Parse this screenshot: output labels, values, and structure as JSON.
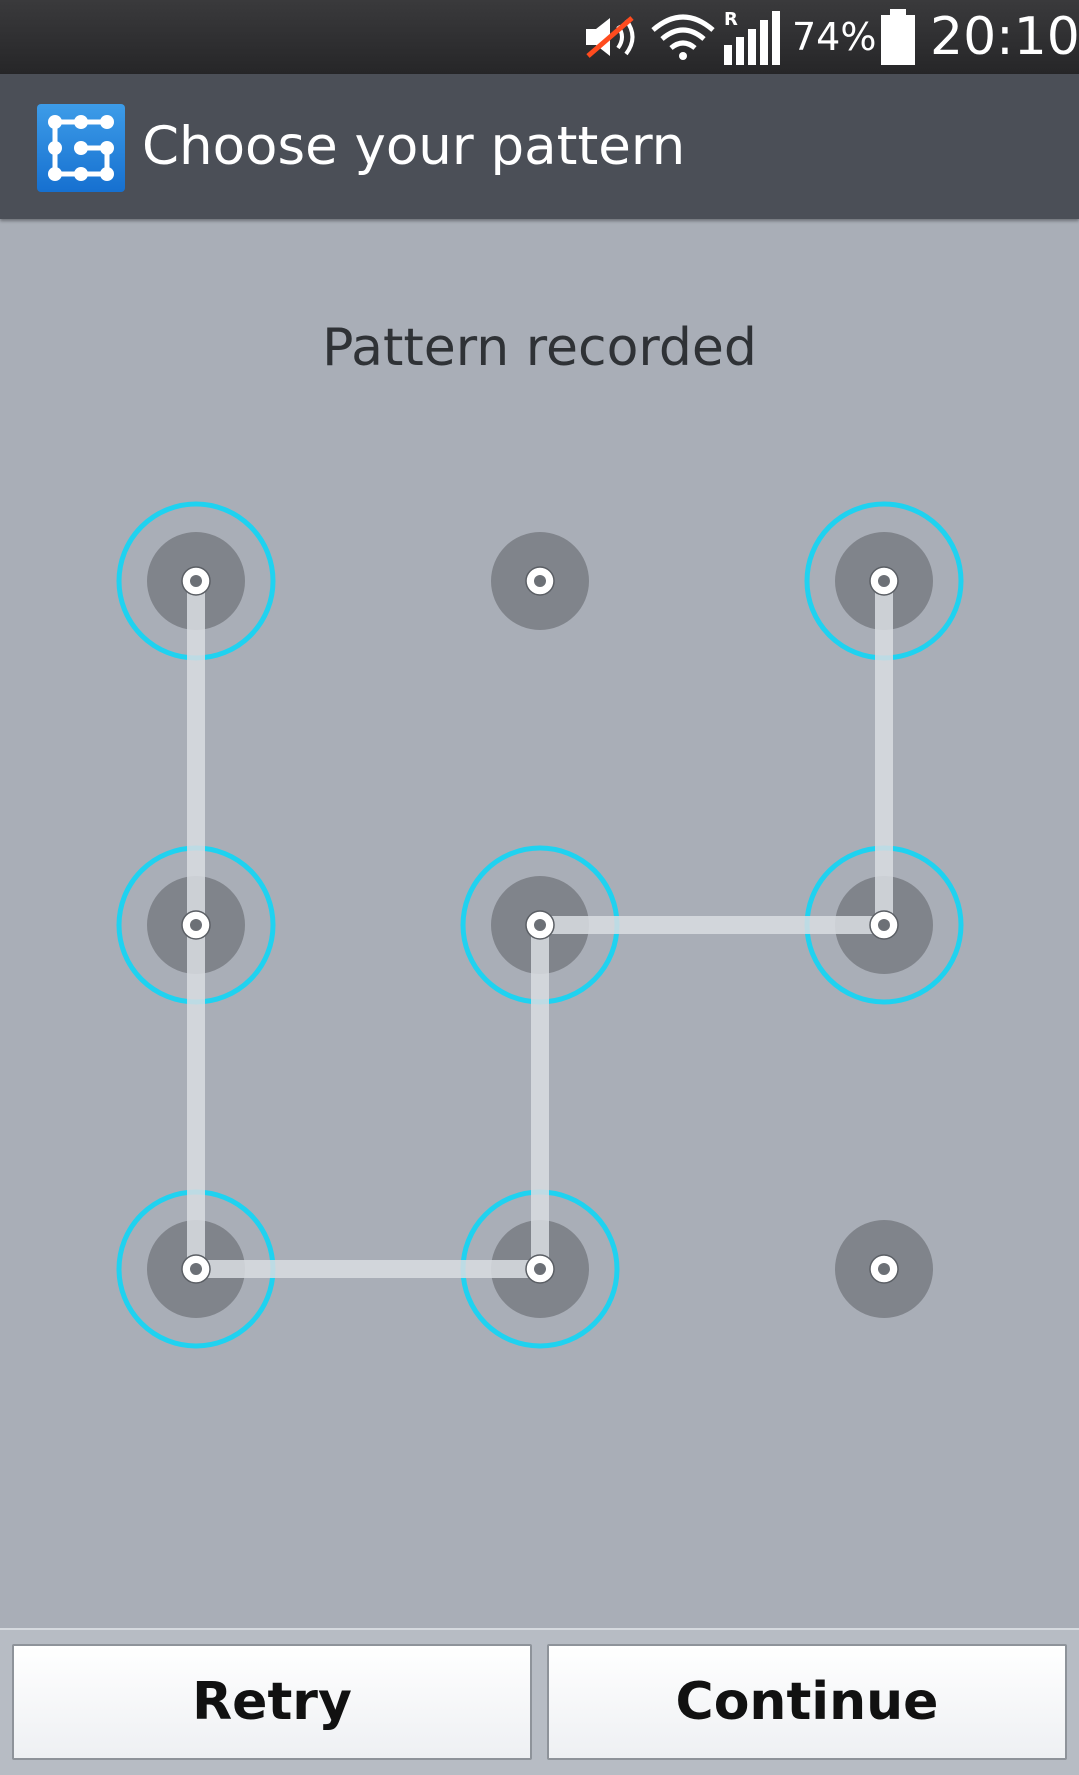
{
  "status_bar": {
    "battery_percent": "74%",
    "time": "20:10",
    "roaming_label": "R",
    "icons": [
      "volume-muted-icon",
      "wifi-icon",
      "signal-icon",
      "battery-icon"
    ]
  },
  "title_bar": {
    "title": "Choose your pattern",
    "icon": "pattern-app-icon",
    "accent_color": "#2a86e0"
  },
  "main": {
    "status_message": "Pattern recorded"
  },
  "pattern": {
    "grid_size": 3,
    "selected_dots": [
      1,
      3,
      4,
      5,
      6,
      7,
      8
    ],
    "path_sequence": [
      3,
      6,
      5,
      8,
      7,
      4,
      1
    ],
    "ring_color": "#1fd2f0",
    "line_color": "#d9dde2"
  },
  "buttons": {
    "retry_label": "Retry",
    "continue_label": "Continue"
  }
}
